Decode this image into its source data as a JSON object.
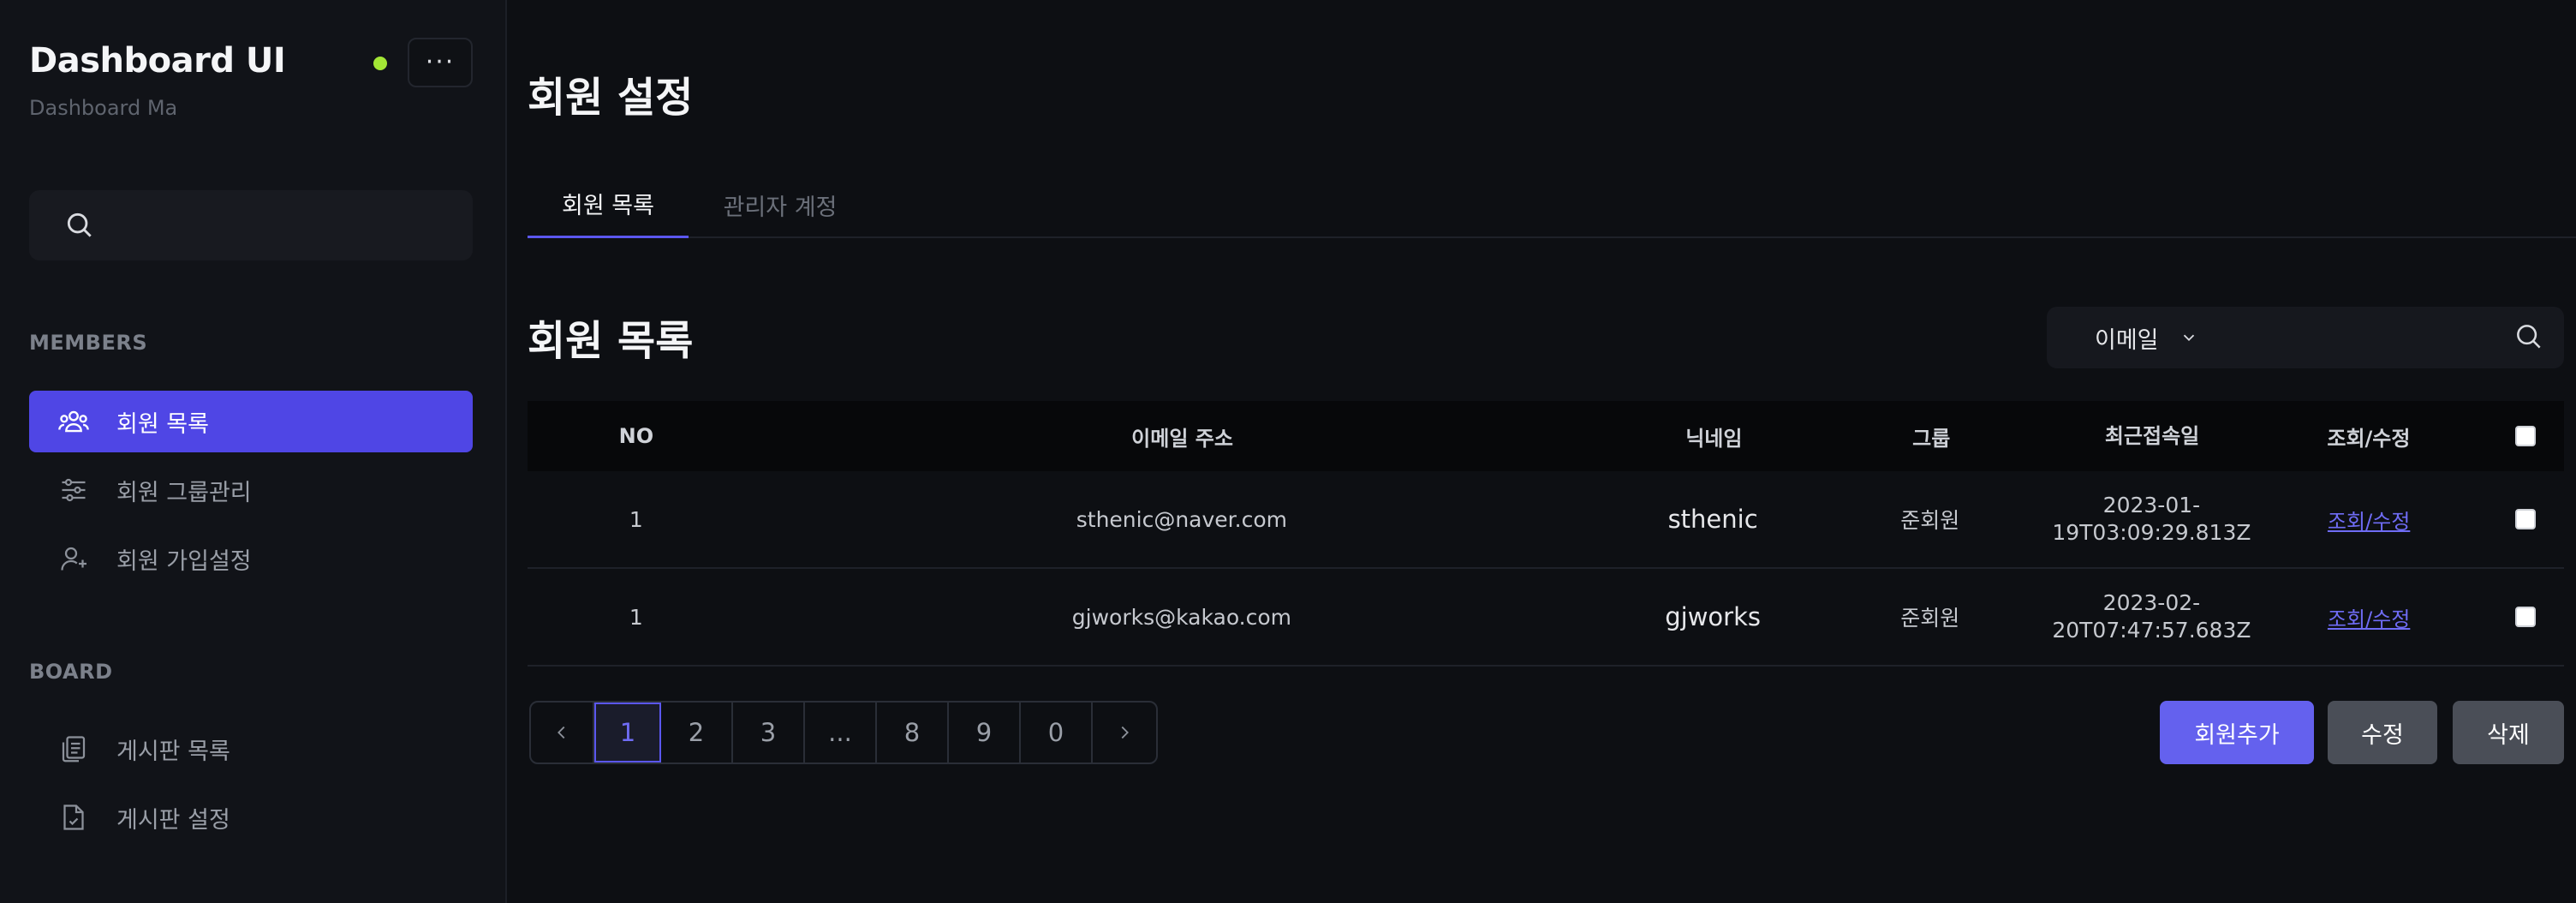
{
  "brand": {
    "title": "Dashboard UI",
    "subtitle": "Dashboard Ma",
    "more_label": "···",
    "status_color": "#a3e635"
  },
  "sidebar": {
    "sections": [
      {
        "label": "MEMBERS",
        "items": [
          {
            "label": "회원 목록",
            "icon": "users-icon",
            "active": true
          },
          {
            "label": "회원 그룹관리",
            "icon": "sliders-icon",
            "active": false
          },
          {
            "label": "회원 가입설정",
            "icon": "user-plus-icon",
            "active": false
          }
        ]
      },
      {
        "label": "BOARD",
        "items": [
          {
            "label": "게시판 목록",
            "icon": "clipboard-list-icon",
            "active": false
          },
          {
            "label": "게시판 설정",
            "icon": "file-settings-icon",
            "active": false
          }
        ]
      }
    ]
  },
  "page": {
    "title": "회원 설정"
  },
  "tabs": [
    {
      "label": "회원 목록",
      "active": true
    },
    {
      "label": "관리자 계정",
      "active": false
    }
  ],
  "list": {
    "title": "회원 목록",
    "filter": {
      "selected": "이메일"
    },
    "columns": [
      "NO",
      "이메일 주소",
      "닉네임",
      "그룹",
      "최근접속일",
      "조회/수정"
    ],
    "rows": [
      {
        "no": "1",
        "email": "sthenic@naver.com",
        "nickname": "sthenic",
        "group": "준회원",
        "date_line1": "2023-01-",
        "date_line2": "19T03:09:29.813Z",
        "action": "조회/수정"
      },
      {
        "no": "1",
        "email": "gjworks@kakao.com",
        "nickname": "gjworks",
        "group": "준회원",
        "date_line1": "2023-02-",
        "date_line2": "20T07:47:57.683Z",
        "action": "조회/수정"
      }
    ]
  },
  "pagination": {
    "pages": [
      "1",
      "2",
      "3",
      "...",
      "8",
      "9",
      "0"
    ],
    "current": "1"
  },
  "actions": {
    "add": "회원추가",
    "edit": "수정",
    "delete": "삭제"
  },
  "colors": {
    "accent": "#4f46e5",
    "button_primary": "#6461ee",
    "button_secondary": "#4a4e57",
    "link": "#6f6cf5"
  }
}
